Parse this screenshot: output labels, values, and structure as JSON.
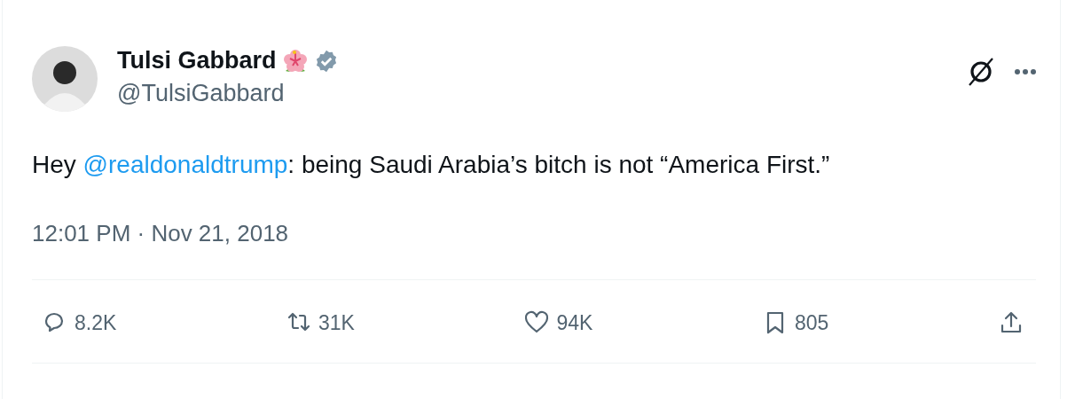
{
  "author": {
    "name": "Tulsi Gabbard",
    "handle": "@TulsiGabbard",
    "verified": true
  },
  "text_parts": [
    {
      "kind": "text",
      "text": "Hey "
    },
    {
      "kind": "mention",
      "text": "@realdonaldtrump"
    },
    {
      "kind": "text",
      "text": ": being Saudi Arabia’s bitch is not “America First.”"
    }
  ],
  "timestamp": "12:01 PM · Nov 21, 2018",
  "actions": [
    {
      "kind": "reply",
      "count": "8.2K"
    },
    {
      "kind": "repost",
      "count": "31K"
    },
    {
      "kind": "like",
      "count": "94K"
    },
    {
      "kind": "bookmark",
      "count": "805"
    },
    {
      "kind": "share"
    }
  ]
}
